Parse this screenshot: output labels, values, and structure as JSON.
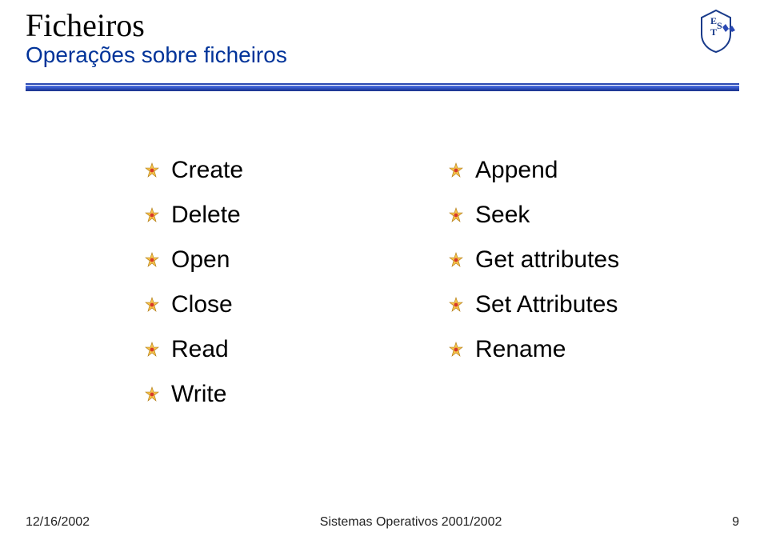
{
  "header": {
    "title": "Ficheiros",
    "subtitle": "Operações sobre ficheiros"
  },
  "columns": {
    "left": [
      "Create",
      "Delete",
      "Open",
      "Close",
      "Read",
      "Write"
    ],
    "right": [
      "Append",
      "Seek",
      "Get attributes",
      "Set Attributes",
      "Rename"
    ]
  },
  "footer": {
    "date": "12/16/2002",
    "center": "Sistemas Operativos 2001/2002",
    "page": "9"
  }
}
